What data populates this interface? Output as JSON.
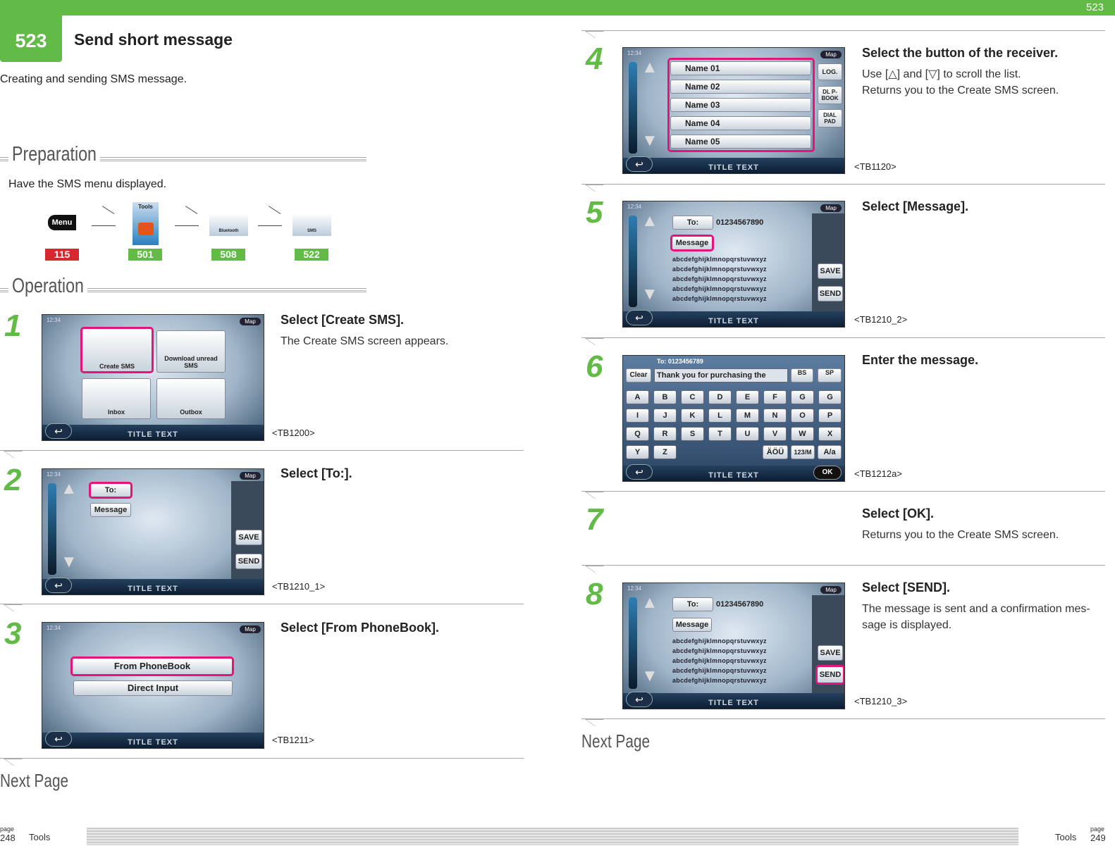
{
  "header": {
    "page_top": "523",
    "chapter": "523",
    "title": "Send short message",
    "lead": "Creating and sending SMS message."
  },
  "preparation": {
    "heading": "Preparation",
    "text": "Have the SMS menu displayed.",
    "path": [
      {
        "icon": "menu-button-icon",
        "label": "Menu",
        "ref": "115",
        "ref_color": "#d7282f"
      },
      {
        "icon": "tools-icon",
        "label": "Tools",
        "ref": "501",
        "ref_color": "#62bb47"
      },
      {
        "icon": "bluetooth-icon",
        "label": "Bluetooth",
        "ref": "508",
        "ref_color": "#62bb47"
      },
      {
        "icon": "sms-icon",
        "label": "SMS",
        "ref": "522",
        "ref_color": "#62bb47"
      }
    ]
  },
  "operation": {
    "heading": "Operation"
  },
  "screen_common": {
    "clock": "12:34",
    "map": "Map",
    "title_text": "TITLE TEXT"
  },
  "steps": [
    {
      "num": "1",
      "head": "Select [Create SMS].",
      "body": "The Create SMS screen appears.",
      "caption": "<TB1200>",
      "buttons": [
        "Create SMS",
        "Download unread SMS",
        "Inbox",
        "Outbox"
      ]
    },
    {
      "num": "2",
      "head": "Select [To:].",
      "body": "",
      "caption": "<TB1210_1>",
      "buttons": [
        "To:",
        "Message",
        "SAVE",
        "SEND"
      ]
    },
    {
      "num": "3",
      "head": "Select [From PhoneBook].",
      "body": "",
      "caption": "<TB1211>",
      "buttons": [
        "From PhoneBook",
        "Direct Input"
      ]
    },
    {
      "num": "4",
      "head": "Select the button of the receiver.",
      "body1": "Use [△] and [▽] to scroll the list.",
      "body2": "Returns you to the Create SMS screen.",
      "caption": "<TB1120>",
      "names": [
        "Name 01",
        "Name 02",
        "Name 03",
        "Name 04",
        "Name 05"
      ],
      "buttons": [
        "LOG.",
        "DL P-BOOK",
        "DIAL PAD"
      ]
    },
    {
      "num": "5",
      "head": "Select [Message].",
      "body": "",
      "caption": "<TB1210_2>",
      "to": "01234567890",
      "lines": "abcdefghijklmnopqrstuvwxyz",
      "buttons": [
        "To:",
        "Message",
        "SAVE",
        "SEND"
      ]
    },
    {
      "num": "6",
      "head": "Enter the message.",
      "body": "",
      "caption": "<TB1212a>",
      "to": "To: 0123456789",
      "input": "Thank you for purchasing the",
      "buttons": [
        "Clear",
        "BS",
        "SP",
        "ÄÖÜ",
        "123/M",
        "A/a",
        "OK"
      ],
      "keys": [
        "A",
        "B",
        "C",
        "D",
        "E",
        "F",
        "G",
        "G",
        "I",
        "J",
        "K",
        "L",
        "M",
        "N",
        "O",
        "P",
        "Q",
        "R",
        "S",
        "T",
        "U",
        "V",
        "W",
        "X",
        "Y",
        "Z"
      ]
    },
    {
      "num": "7",
      "head": "Select [OK].",
      "body": "Returns you to the Create SMS screen."
    },
    {
      "num": "8",
      "head": "Select [SEND].",
      "body1": "The message is sent and a confirmation mes-",
      "body2": "sage is displayed.",
      "caption": "<TB1210_3>",
      "to": "01234567890",
      "lines": "abcdefghijklmnopqrstuvwxyz",
      "buttons": [
        "To:",
        "Message",
        "SAVE",
        "SEND"
      ]
    }
  ],
  "next_page": "Next Page",
  "footer": {
    "left_page_label": "page",
    "left_page": "248",
    "left_section": "Tools",
    "right_section": "Tools",
    "right_page_label": "page",
    "right_page": "249"
  }
}
